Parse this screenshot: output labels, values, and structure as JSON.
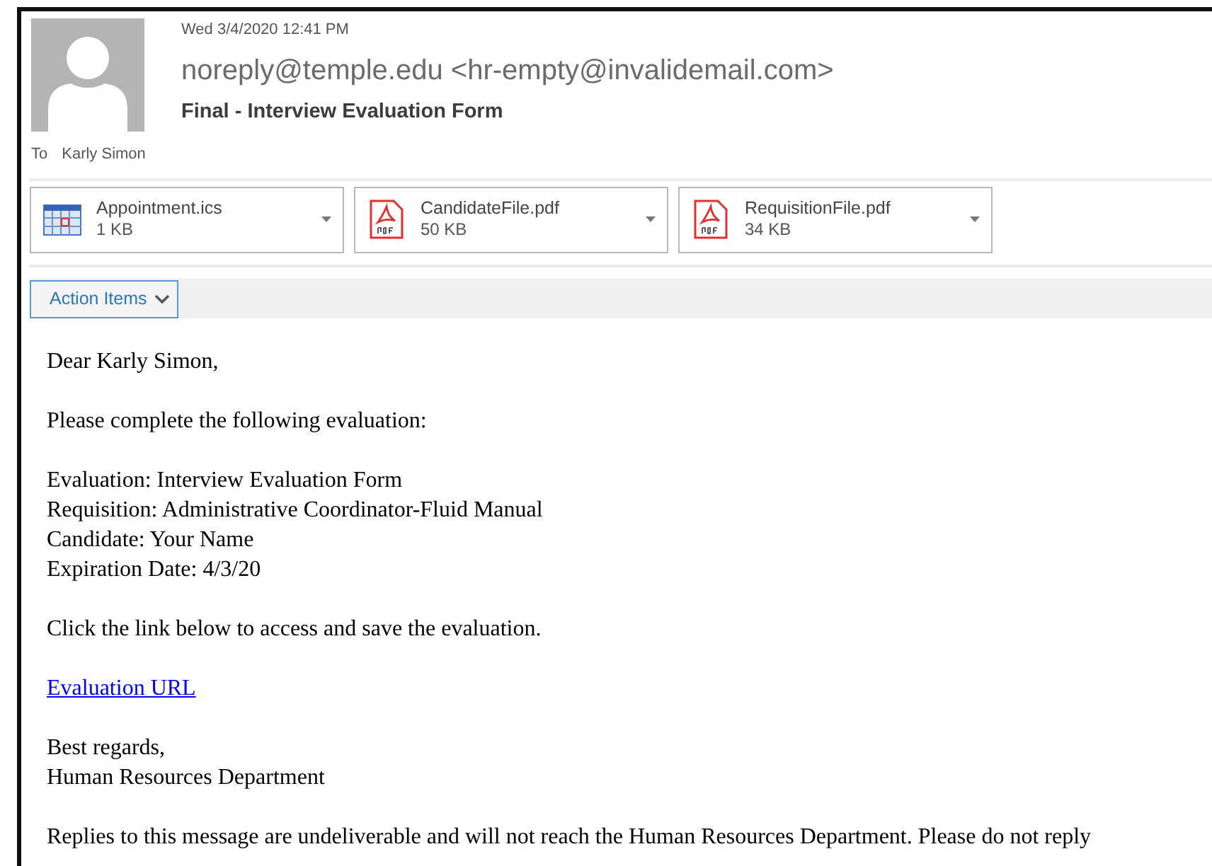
{
  "header": {
    "date": "Wed 3/4/2020 12:41 PM",
    "from": "noreply@temple.edu <hr-empty@invalidemail.com>",
    "subject": "Final - Interview Evaluation Form",
    "to_label": "To",
    "to": "Karly Simon"
  },
  "attachments": [
    {
      "kind": "calendar",
      "name": "Appointment.ics",
      "size": "1 KB"
    },
    {
      "kind": "pdf",
      "name": "CandidateFile.pdf",
      "size": "50 KB"
    },
    {
      "kind": "pdf",
      "name": "RequisitionFile.pdf",
      "size": "34 KB"
    }
  ],
  "action_items": {
    "label": "Action Items"
  },
  "body": [
    {
      "kind": "text",
      "lines": [
        "Dear Karly Simon,"
      ]
    },
    {
      "kind": "text",
      "lines": [
        "Please complete the following evaluation:"
      ]
    },
    {
      "kind": "text",
      "lines": [
        "Evaluation: Interview Evaluation Form",
        "Requisition: Administrative Coordinator-Fluid Manual",
        "Candidate: Your Name",
        "Expiration Date: 4/3/20"
      ]
    },
    {
      "kind": "text",
      "lines": [
        "Click the link below to access and save the evaluation."
      ]
    },
    {
      "kind": "link",
      "lines": [
        "Evaluation URL"
      ]
    },
    {
      "kind": "text",
      "lines": [
        "Best regards,",
        "Human Resources Department"
      ]
    },
    {
      "kind": "text",
      "lines": [
        "Replies to this message are undeliverable and will not reach the Human Resources Department. Please do not reply"
      ]
    }
  ]
}
